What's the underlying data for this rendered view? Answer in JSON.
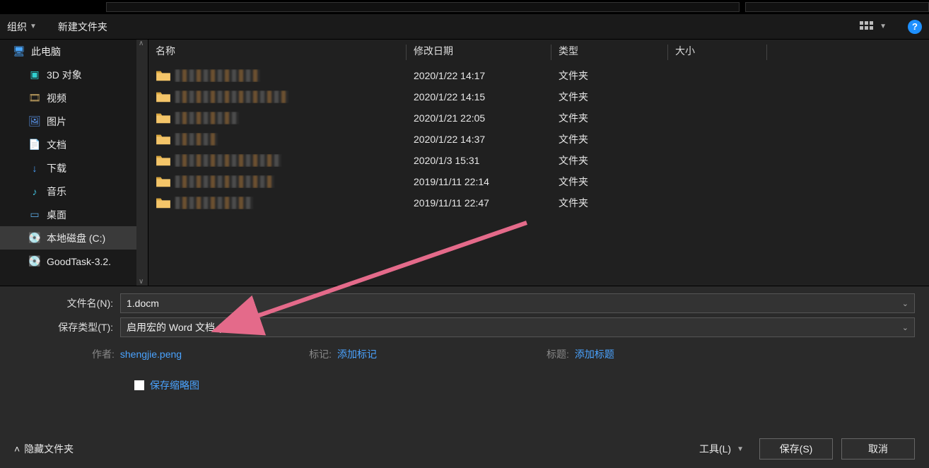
{
  "toolbar": {
    "organize": "组织",
    "new_folder": "新建文件夹",
    "help": "?"
  },
  "sidebar": {
    "root": "此电脑",
    "items": [
      {
        "label": "3D 对象"
      },
      {
        "label": "视频"
      },
      {
        "label": "图片"
      },
      {
        "label": "文档"
      },
      {
        "label": "下载"
      },
      {
        "label": "音乐"
      },
      {
        "label": "桌面"
      },
      {
        "label": "本地磁盘 (C:)"
      },
      {
        "label": "GoodTask-3.2."
      }
    ]
  },
  "columns": {
    "name": "名称",
    "date": "修改日期",
    "type": "类型",
    "size": "大小"
  },
  "rows": [
    {
      "date": "2020/1/22 14:17",
      "type": "文件夹"
    },
    {
      "date": "2020/1/22 14:15",
      "type": "文件夹"
    },
    {
      "date": "2020/1/21 22:05",
      "type": "文件夹"
    },
    {
      "date": "2020/1/22 14:37",
      "type": "文件夹"
    },
    {
      "date": "2020/1/3 15:31",
      "type": "文件夹"
    },
    {
      "date": "2019/11/11 22:14",
      "type": "文件夹"
    },
    {
      "date": "2019/11/11 22:47",
      "type": "文件夹"
    }
  ],
  "filename": {
    "label": "文件名(N):",
    "value": "1.docm"
  },
  "savetype": {
    "label": "保存类型(T):",
    "value": "启用宏的 Word 文档 (*.docm)"
  },
  "meta": {
    "author_k": "作者:",
    "author_v": "shengjie.peng",
    "tag_k": "标记:",
    "tag_v": "添加标记",
    "title_k": "标题:",
    "title_v": "添加标题"
  },
  "thumb": {
    "label": "保存缩略图"
  },
  "footer": {
    "hide": "隐藏文件夹",
    "tools": "工具(L)",
    "save": "保存(S)",
    "cancel": "取消"
  }
}
